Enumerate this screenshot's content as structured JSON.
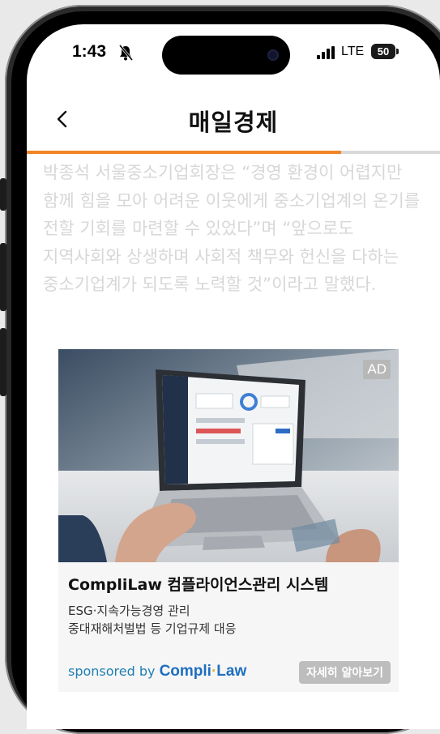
{
  "status_bar": {
    "time": "1:43",
    "network": "LTE",
    "battery": "50"
  },
  "nav": {
    "title": "매일경제"
  },
  "reading_progress": 0.76,
  "article": {
    "text": "박종석 서울중소기업회장은 “경영 환경이 어렵지만 함께 힘을 모아 어려운 이웃에게 중소기업계의 온기를 전할 기회를 마련할 수 있었다”며 “앞으로도 지역사회와 상생하며 사회적 책무와 헌신을 다하는 중소기업계가 되도록 노력할 것”이라고 말했다."
  },
  "ad": {
    "badge": "AD",
    "title": "CompliLaw 컴플라이언스관리 시스템",
    "line1": "ESG·지속가능경영 관리",
    "line2": "중대재해처벌법 등 기업규제 대응",
    "sponsored_by": "sponsored by",
    "brand_part1": "Compli",
    "brand_dot": "·",
    "brand_part2": "Law",
    "button": "자세히 알아보기"
  },
  "colors": {
    "accent": "#f28524",
    "sponsor": "#1f7eb5",
    "faded_text": "#d7d7d7"
  }
}
